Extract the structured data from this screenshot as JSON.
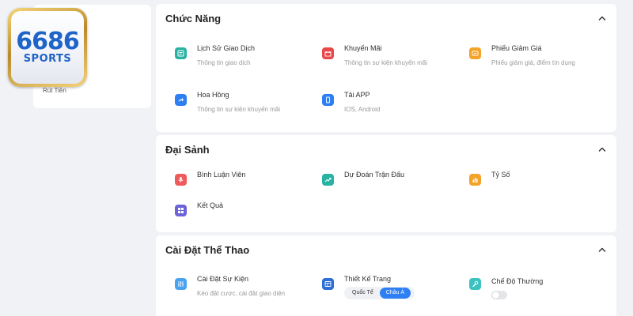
{
  "logo": {
    "number": "6686",
    "sub": "SPORTS"
  },
  "left_card": {
    "withdraw_label": "Rút Tiền"
  },
  "sections": {
    "functions": {
      "title": "Chức Năng",
      "items": [
        {
          "name": "Lịch Sử Giao Dịch",
          "desc": "Thông tin giao dịch"
        },
        {
          "name": "Khuyến Mãi",
          "desc": "Thông tin sự kiện khuyến mãi"
        },
        {
          "name": "Phiếu Giảm Giá",
          "desc": "Phiếu giảm giá, điểm tín dụng"
        },
        {
          "name": "Hoa Hồng",
          "desc": "Thông tin sự kiện khuyến mãi"
        },
        {
          "name": "Tải APP",
          "desc": "IOS, Android"
        }
      ]
    },
    "lobby": {
      "title": "Đại Sảnh",
      "items": [
        {
          "name": "Bình Luận Viên"
        },
        {
          "name": "Dự Đoán Trận Đấu"
        },
        {
          "name": "Tỷ Số"
        },
        {
          "name": "Kết Quả"
        }
      ]
    },
    "sports_settings": {
      "title": "Cài Đặt Thể Thao",
      "items": [
        {
          "name": "Cài Đặt Sự Kiện",
          "desc": "Kéo đặt cược, cài đặt giao diện"
        },
        {
          "name": "Thiết Kế Trang",
          "options": [
            "Quốc Tế",
            "Châu Á"
          ],
          "selected": "Châu Á"
        },
        {
          "name": "Chế Độ Thường",
          "toggle_on": false
        }
      ]
    }
  },
  "colors": {
    "accent": "#2e7ff3",
    "icon_transactions": "#27b2a2",
    "icon_promo": "#e94848",
    "icon_coupon": "#f4a32a",
    "icon_commission": "#2e7ff3",
    "icon_app": "#2e7ff3",
    "icon_commentator": "#ef5b5b",
    "icon_prediction": "#27b2a2",
    "icon_score": "#f4a32a",
    "icon_results": "#6c63d8",
    "icon_event_settings": "#4ba3f0",
    "icon_page_design": "#2e6fd6",
    "icon_normal_mode": "#3cc3c0"
  },
  "icons": {
    "transactions": "list-icon",
    "promo": "gift-icon",
    "coupon": "ticket-icon",
    "commission": "share-icon",
    "app": "phone-icon",
    "commentator": "microphone-icon",
    "prediction": "trend-icon",
    "score": "bar-chart-icon",
    "results": "grid-icon",
    "event_settings": "sliders-icon",
    "page_design": "layout-icon",
    "normal_mode": "wrench-icon",
    "collapse": "chevron-up-icon"
  }
}
